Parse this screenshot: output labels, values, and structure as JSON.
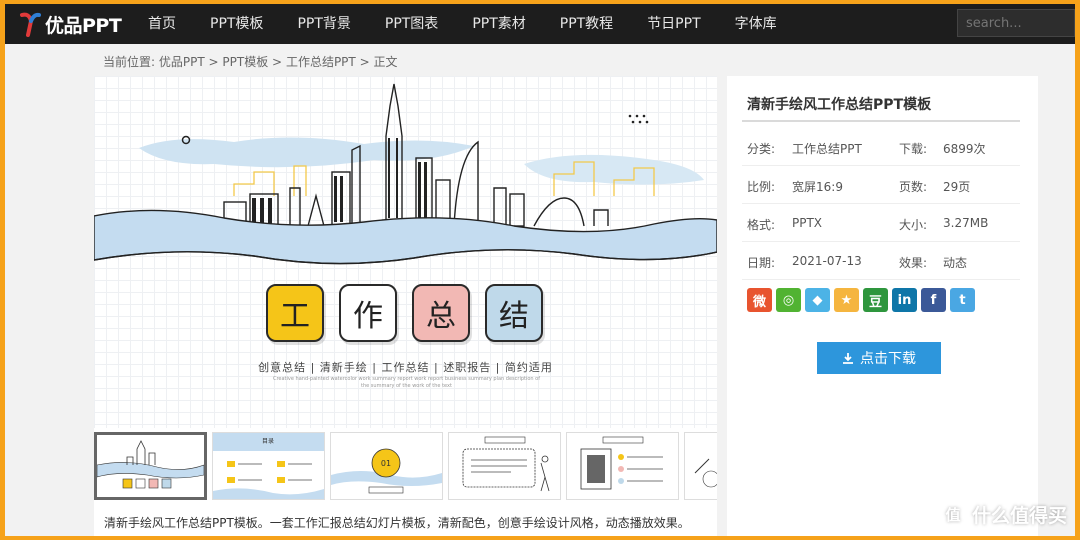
{
  "site": {
    "logo_text": "优品PPT"
  },
  "nav": [
    "首页",
    "PPT模板",
    "PPT背景",
    "PPT图表",
    "PPT素材",
    "PPT教程",
    "节日PPT",
    "字体库"
  ],
  "search": {
    "placeholder": "search..."
  },
  "breadcrumb": {
    "prefix": "当前位置:",
    "items": [
      "优品PPT",
      "PPT模板",
      "工作总结PPT",
      "正文"
    ],
    "sep": ">"
  },
  "slide": {
    "tiles": [
      "工",
      "作",
      "总",
      "结"
    ],
    "tile_colors": [
      "#f5c518",
      "#ffffff",
      "#f2b8b4",
      "#bfd9ea"
    ],
    "subtitle": "创意总结 | 清新手绘 | 工作总结 | 述职报告 | 简约适用",
    "subtitle_en": "Creative hand-painted watercolor work summary report work report business summary plan description of the summary of the work of the text"
  },
  "thumbs": [
    {
      "label": "",
      "active": true
    },
    {
      "label": "目录",
      "active": false
    },
    {
      "label": "01",
      "active": false
    },
    {
      "label": "",
      "active": false
    },
    {
      "label": "",
      "active": false
    },
    {
      "label": "",
      "active": false
    }
  ],
  "description": "清新手绘风工作总结PPT模板。一套工作汇报总结幻灯片模板，清新配色，创意手绘设计风格，动态播放效果。",
  "panel": {
    "title": "清新手绘风工作总结PPT模板",
    "rows": [
      {
        "k1": "分类:",
        "v1": "工作总结PPT",
        "k2": "下载:",
        "v2": "6899次"
      },
      {
        "k1": "比例:",
        "v1": "宽屏16:9",
        "k2": "页数:",
        "v2": "29页"
      },
      {
        "k1": "格式:",
        "v1": "PPTX",
        "k2": "大小:",
        "v2": "3.27MB"
      },
      {
        "k1": "日期:",
        "v1": "2021-07-13",
        "k2": "效果:",
        "v2": "动态"
      }
    ],
    "share": [
      {
        "icon": "weibo-icon",
        "glyph": "微",
        "color": "#e8542f"
      },
      {
        "icon": "wechat-icon",
        "glyph": "◎",
        "color": "#51b332"
      },
      {
        "icon": "qq-icon",
        "glyph": "◆",
        "color": "#4cb3e6"
      },
      {
        "icon": "qzone-icon",
        "glyph": "★",
        "color": "#f5b53f"
      },
      {
        "icon": "douban-icon",
        "glyph": "豆",
        "color": "#2e963d"
      },
      {
        "icon": "linkedin-icon",
        "glyph": "in",
        "color": "#0e76a8"
      },
      {
        "icon": "facebook-icon",
        "glyph": "f",
        "color": "#3b5998"
      },
      {
        "icon": "twitter-icon",
        "glyph": "t",
        "color": "#4aa7e3"
      }
    ],
    "download_label": "点击下载"
  },
  "watermark": {
    "text": "什么值得买",
    "glyph": "值"
  }
}
